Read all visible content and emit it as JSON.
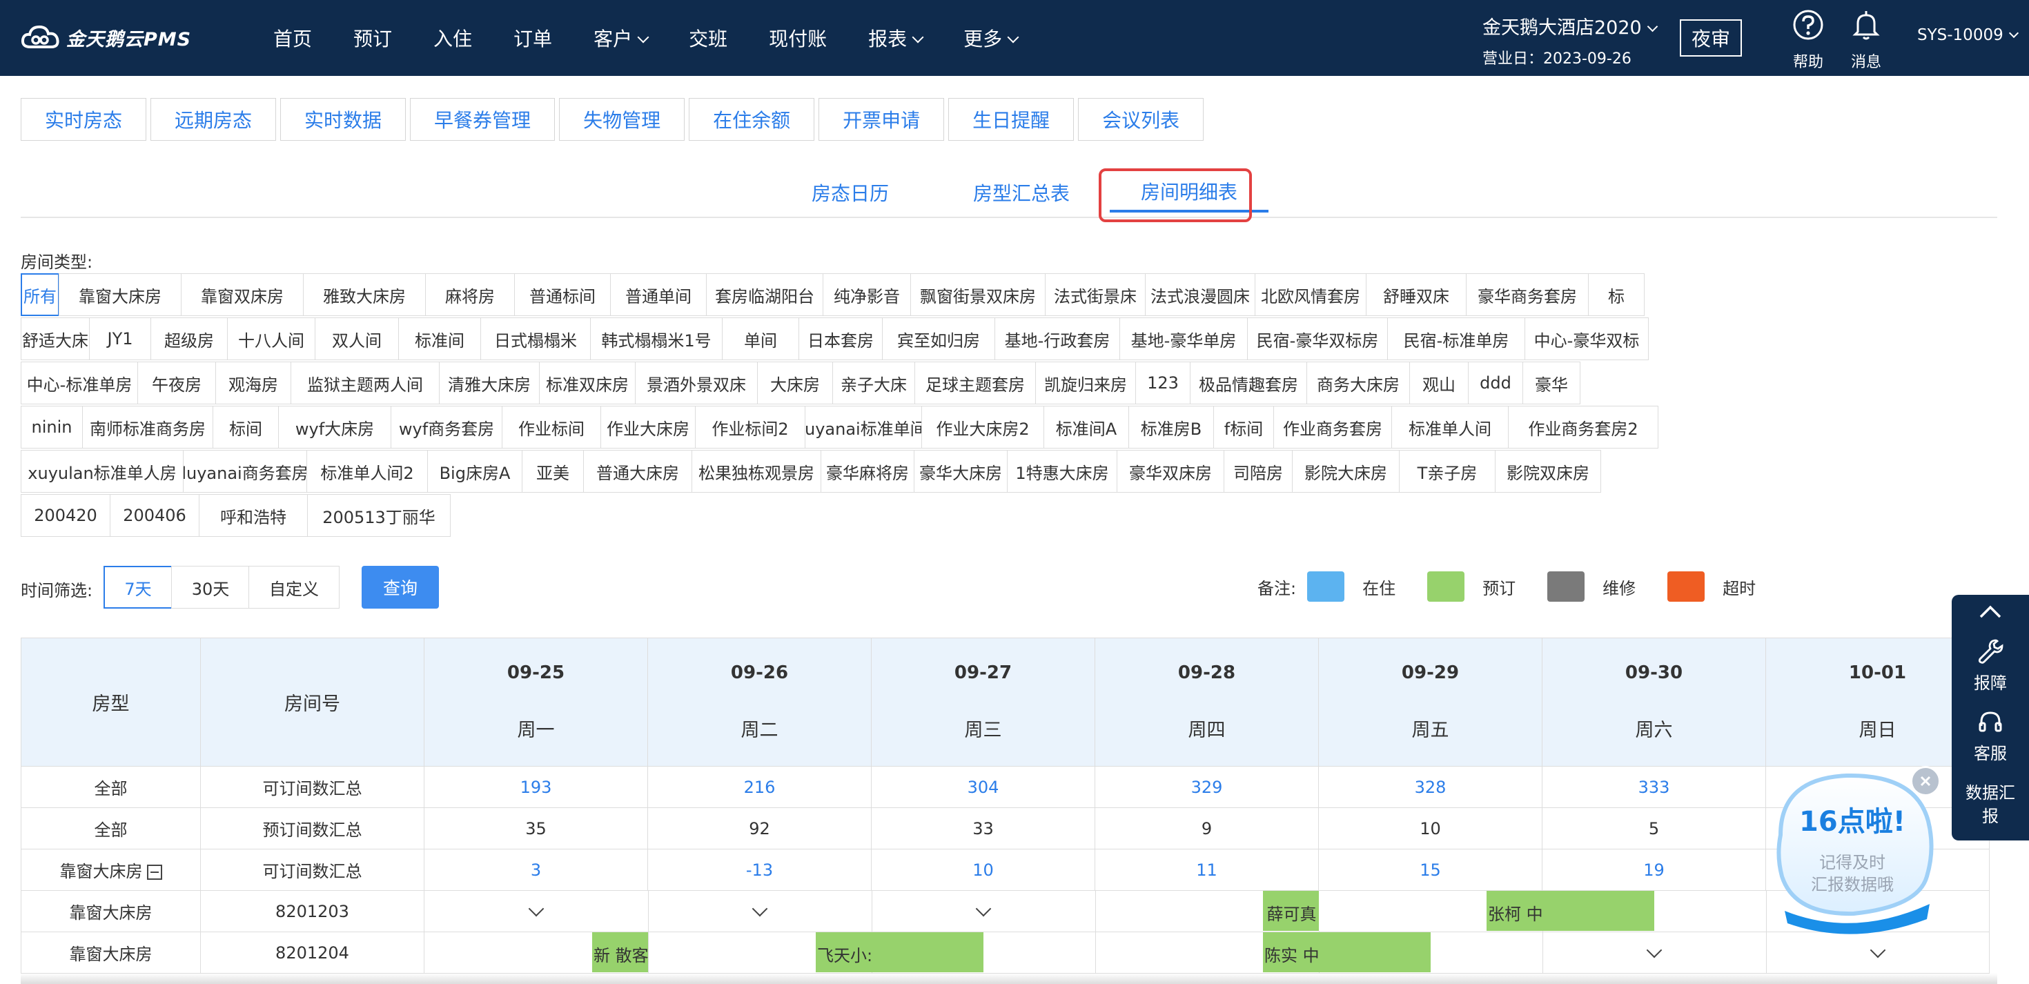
{
  "app": {
    "logo_text": "金天鹅云PMS"
  },
  "nav": [
    {
      "label": "首页",
      "dropdown": false
    },
    {
      "label": "预订",
      "dropdown": false
    },
    {
      "label": "入住",
      "dropdown": false
    },
    {
      "label": "订单",
      "dropdown": false
    },
    {
      "label": "客户",
      "dropdown": true
    },
    {
      "label": "交班",
      "dropdown": false
    },
    {
      "label": "现付账",
      "dropdown": false
    },
    {
      "label": "报表",
      "dropdown": true
    },
    {
      "label": "更多",
      "dropdown": true
    }
  ],
  "hotel": {
    "name": "金天鹅大酒店2020",
    "business_date": "营业日：2023-09-26"
  },
  "night_audit": "夜审",
  "help_label": "帮助",
  "message_label": "消息",
  "user_id": "SYS-10009",
  "func_tabs": [
    "实时房态",
    "远期房态",
    "实时数据",
    "早餐券管理",
    "失物管理",
    "在住余额",
    "开票申请",
    "生日提醒",
    "会议列表"
  ],
  "sub_tabs": [
    {
      "label": "房态日历",
      "active": false
    },
    {
      "label": "房型汇总表",
      "active": false
    },
    {
      "label": "房间明细表",
      "active": true
    }
  ],
  "room_type_label": "房间类型:",
  "room_types": [
    [
      "所有",
      "靠窗大床房",
      "靠窗双床房",
      "雅致大床房",
      "麻将房",
      "普通标间",
      "普通单间",
      "套房临湖阳台",
      "纯净影音",
      "飘窗街景双床房",
      "法式街景床",
      "法式浪漫圆床",
      "北欧风情套房",
      "舒睡双床",
      "豪华商务套房",
      "标"
    ],
    [
      "舒适大床",
      "JY1",
      "超级房",
      "十八人间",
      "双人间",
      "标准间",
      "日式榻榻米",
      "韩式榻榻米1号",
      "单间",
      "日本套房",
      "宾至如归房",
      "基地-行政套房",
      "基地-豪华单房",
      "民宿-豪华双标房",
      "民宿-标准单房",
      "中心-豪华双标"
    ],
    [
      "中心-标准单房",
      "午夜房",
      "观海房",
      "监狱主题两人间",
      "清雅大床房",
      "标准双床房",
      "景酒外景双床",
      "大床房",
      "亲子大床",
      "足球主题套房",
      "凯旋归来房",
      "123",
      "极品情趣套房",
      "商务大床房",
      "观山",
      "ddd",
      "豪华"
    ],
    [
      "ninin",
      "南师标准商务房",
      "标间",
      "wyf大床房",
      "wyf商务套房",
      "作业标间",
      "作业大床房",
      "作业标间2",
      "luyanai标准单间",
      "作业大床房2",
      "标准间A",
      "标准房B",
      "f标间",
      "作业商务套房",
      "标准单人间",
      "作业商务套房2"
    ],
    [
      "xuyulan标准单人房",
      "luyanai商务套房",
      "标准单人间2",
      "Big床房A",
      "亚美",
      "普通大床房",
      "松果独栋观景房",
      "豪华麻将房",
      "豪华大床房",
      "1特惠大床房",
      "豪华双床房",
      "司陪房",
      "影院大床房",
      "T亲子房",
      "影院双床房"
    ],
    [
      "200420",
      "200406",
      "呼和浩特",
      "200513丁丽华"
    ]
  ],
  "time_filter": {
    "label": "时间筛选:",
    "options": [
      "7天",
      "30天",
      "自定义"
    ],
    "selected": "7天",
    "query_label": "查询"
  },
  "legend": {
    "label": "备注:",
    "items": [
      {
        "label": "在住",
        "color": "#5cb3f0"
      },
      {
        "label": "预订",
        "color": "#97d26c"
      },
      {
        "label": "维修",
        "color": "#7a7a7a"
      },
      {
        "label": "超时",
        "color": "#ef5d23"
      }
    ]
  },
  "grid": {
    "col_room_type": "房型",
    "col_room_no": "房间号",
    "dates": [
      {
        "date": "09-25",
        "day": "周一"
      },
      {
        "date": "09-26",
        "day": "周二"
      },
      {
        "date": "09-27",
        "day": "周三"
      },
      {
        "date": "09-28",
        "day": "周四"
      },
      {
        "date": "09-29",
        "day": "周五"
      },
      {
        "date": "09-30",
        "day": "周六"
      },
      {
        "date": "10-01",
        "day": "周日"
      }
    ],
    "summary_rows": [
      {
        "type": "全部",
        "label": "可订间数汇总",
        "values": [
          "193",
          "216",
          "304",
          "329",
          "328",
          "333",
          ""
        ],
        "blue": true,
        "collapse": false
      },
      {
        "type": "全部",
        "label": "预订间数汇总",
        "values": [
          "35",
          "92",
          "33",
          "9",
          "10",
          "5",
          ""
        ],
        "blue": false,
        "collapse": false
      },
      {
        "type": "靠窗大床房",
        "label": "可订间数汇总",
        "values": [
          "3",
          "-13",
          "10",
          "11",
          "15",
          "19",
          ""
        ],
        "blue": true,
        "collapse": true
      }
    ],
    "room_rows": [
      {
        "type": "靠窗大床房",
        "room": "8201203",
        "check_days": [
          0,
          1,
          2
        ],
        "bookings": [
          {
            "text": "薛可真",
            "start_day": 3.75,
            "end_day": 4.0,
            "color": "#97d26c"
          },
          {
            "text": "",
            "start_day": 4.0,
            "end_day": 4.75,
            "color": "#ffffff"
          },
          {
            "text": "张柯 中",
            "start_day": 4.75,
            "end_day": 5.0,
            "color": "#97d26c"
          },
          {
            "text": "",
            "start_day": 5.0,
            "end_day": 5.5,
            "color": "#97d26c"
          }
        ]
      },
      {
        "type": "靠窗大床房",
        "room": "8201204",
        "check_days": [
          5,
          6
        ],
        "bookings": [
          {
            "text": "新 散客",
            "start_day": 0.75,
            "end_day": 1.0,
            "color": "#97d26c"
          },
          {
            "text": "飞天小:",
            "start_day": 1.75,
            "end_day": 2.0,
            "color": "#97d26c"
          },
          {
            "text": "",
            "start_day": 2.0,
            "end_day": 2.5,
            "color": "#97d26c"
          },
          {
            "text": "陈实 中",
            "start_day": 3.75,
            "end_day": 4.0,
            "color": "#97d26c"
          },
          {
            "text": "",
            "start_day": 4.0,
            "end_day": 4.5,
            "color": "#97d26c"
          }
        ]
      }
    ]
  },
  "side_panel": {
    "items": [
      "报障",
      "客服",
      "数据汇报"
    ]
  },
  "toast": {
    "headline": "16点啦!",
    "line1": "记得及时",
    "line2": "汇报数据哦"
  }
}
